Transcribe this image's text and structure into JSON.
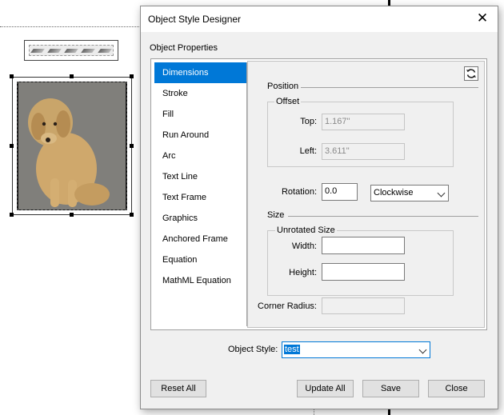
{
  "dialog": {
    "title": "Object Style Designer",
    "group_label": "Object Properties"
  },
  "nav": {
    "items": [
      "Dimensions",
      "Stroke",
      "Fill",
      "Run Around",
      "Arc",
      "Text Line",
      "Text Frame",
      "Graphics",
      "Anchored Frame",
      "Equation",
      "MathML Equation"
    ],
    "selected": "Dimensions"
  },
  "position": {
    "section_label": "Position",
    "offset_label": "Offset",
    "top_label": "Top:",
    "top_value": "1.167\"",
    "left_label": "Left:",
    "left_value": "3.611\"",
    "rotation_label": "Rotation:",
    "rotation_value": "0.0",
    "direction_value": "Clockwise"
  },
  "size": {
    "section_label": "Size",
    "unrotated_label": "Unrotated Size",
    "width_label": "Width:",
    "width_value": "",
    "height_label": "Height:",
    "height_value": ""
  },
  "corner": {
    "label": "Corner Radius:",
    "value": ""
  },
  "object_style": {
    "label": "Object Style:",
    "value": "test"
  },
  "buttons": {
    "reset_all": "Reset All",
    "update_all": "Update All",
    "save": "Save",
    "close": "Close"
  },
  "icons": {
    "close": "close-icon",
    "refresh": "refresh-icon",
    "dropdown": "chevron-down-icon"
  },
  "colors": {
    "accent": "#0078d7"
  }
}
